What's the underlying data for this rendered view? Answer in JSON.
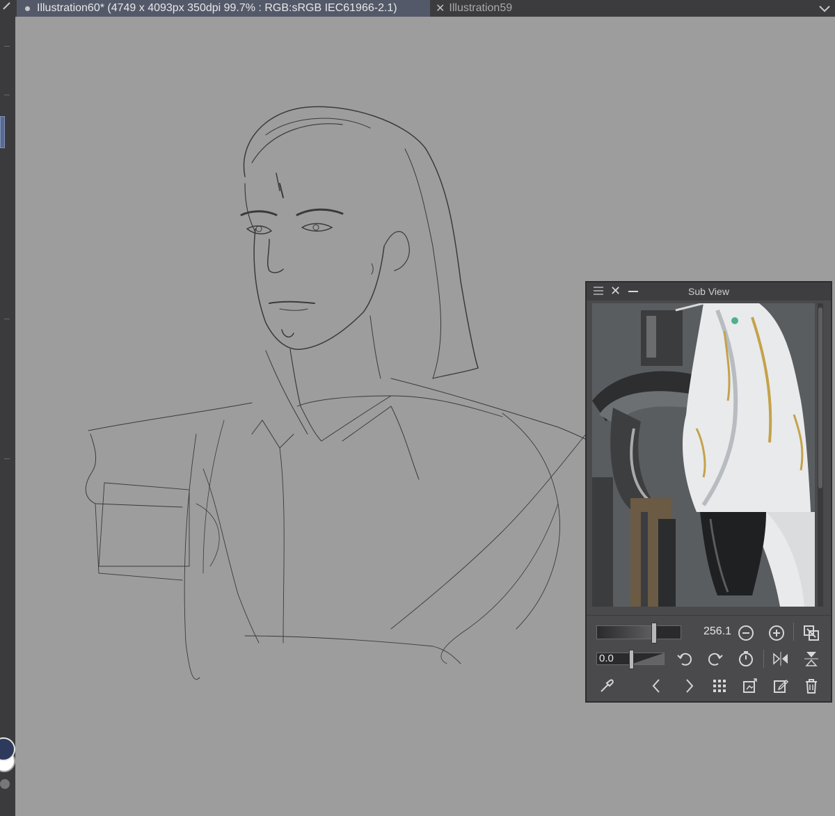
{
  "tabs": {
    "active": {
      "label": "Illustration60* (4749 x 4093px 350dpi 99.7% : RGB:sRGB IEC61966-2.1)"
    },
    "inactive": {
      "label": "Illustration59"
    }
  },
  "subview": {
    "title": "Sub View",
    "zoom_value": "256.1",
    "rotation_value": "0.0",
    "zoom_fraction": 0.7,
    "rotation_fraction": 0.5
  },
  "colors": {
    "canvas": "#9d9d9d",
    "panel": "#4a4a4c",
    "tab_active": "#54596a",
    "foreground_color": "#2e3a5c",
    "background_color": "#ffffff"
  },
  "icons": [
    "pencil-icon",
    "menu-icon",
    "close-icon",
    "minimize-icon",
    "chevron-down-icon",
    "zoom-out-icon",
    "zoom-in-icon",
    "fit-view-icon",
    "rotate-left-icon",
    "rotate-right-icon",
    "reset-rotation-icon",
    "flip-horizontal-icon",
    "flip-vertical-icon",
    "eyedropper-icon",
    "previous-icon",
    "next-icon",
    "grid-icon",
    "import-icon",
    "edit-icon",
    "trash-icon"
  ]
}
